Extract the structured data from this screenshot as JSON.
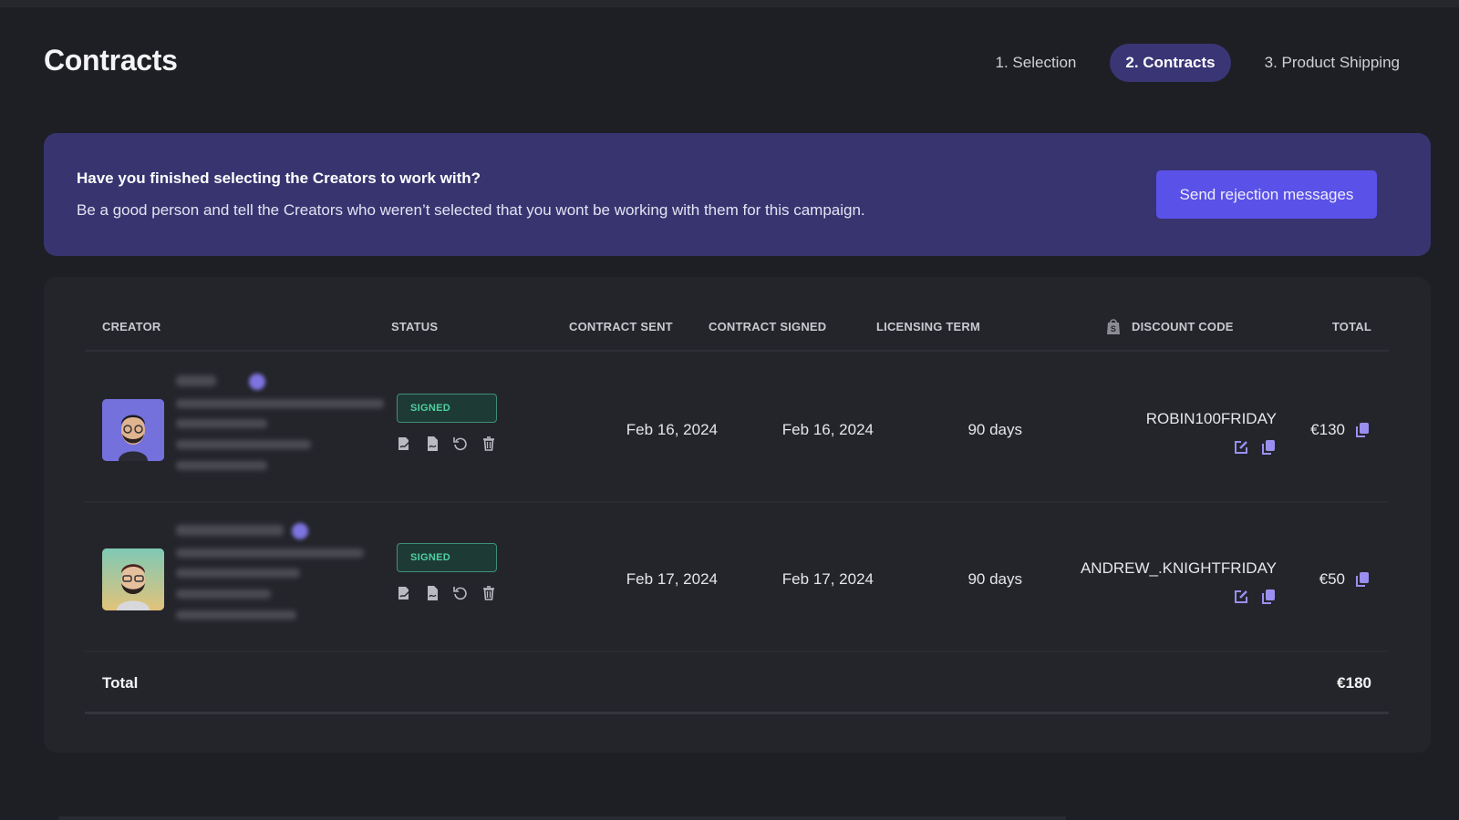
{
  "header": {
    "title": "Contracts",
    "steps": [
      {
        "label": "1. Selection",
        "active": false
      },
      {
        "label": "2. Contracts",
        "active": true
      },
      {
        "label": "3. Product Shipping",
        "active": false
      }
    ]
  },
  "banner": {
    "title": "Have you finished selecting the Creators to work with?",
    "text": "Be a good person and tell the Creators who weren’t selected that you wont be working with them for this campaign.",
    "button_label": "Send rejection messages"
  },
  "table": {
    "columns": {
      "creator": "CREATOR",
      "status": "STATUS",
      "contract_sent": "CONTRACT SENT",
      "contract_signed": "CONTRACT SIGNED",
      "licensing_term": "LICENSING TERM",
      "discount_code": "DISCOUNT CODE",
      "total": "TOTAL"
    },
    "discount_header_icon": "shopify-bag-icon",
    "rows": [
      {
        "creator_info": "blurred",
        "status": "SIGNED",
        "contract_sent": "Feb 16, 2024",
        "contract_signed": "Feb 16, 2024",
        "licensing_term": "90 days",
        "discount_code": "ROBIN100FRIDAY",
        "total": "€130"
      },
      {
        "creator_info": "blurred",
        "status": "SIGNED",
        "contract_sent": "Feb 17, 2024",
        "contract_signed": "Feb 17, 2024",
        "licensing_term": "90 days",
        "discount_code": "ANDREW_.KNIGHTFRIDAY",
        "total": "€50"
      }
    ],
    "row_actions": [
      "sign-contract-icon",
      "pdf-document-icon",
      "resend-icon",
      "trash-icon"
    ],
    "footer": {
      "label": "Total",
      "value": "€180"
    }
  },
  "colors": {
    "accent": "#5a51e8",
    "banner_bg": "#383470",
    "active_step": "#3a3575",
    "signed_green": "#4fd0a2",
    "icon_purple": "#9a8ff0"
  }
}
